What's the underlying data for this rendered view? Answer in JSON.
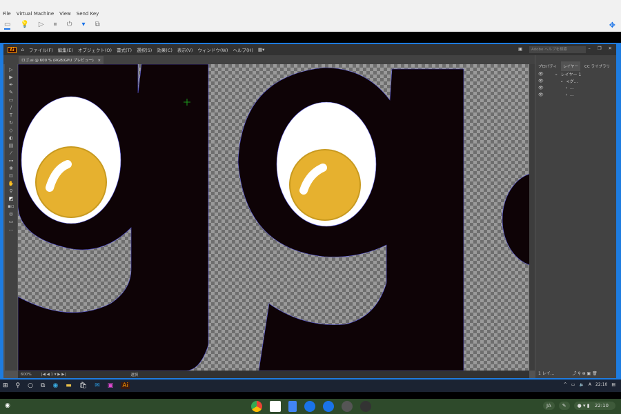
{
  "host": {
    "menu": [
      "File",
      "Virtual Machine",
      "View",
      "Send Key"
    ]
  },
  "illustrator": {
    "logo": "Ai",
    "menu": [
      "ファイル(F)",
      "編集(E)",
      "オブジェクト(O)",
      "書式(T)",
      "選択(S)",
      "効果(C)",
      "表示(V)",
      "ウィンドウ(W)",
      "ヘルプ(H)"
    ],
    "search_placeholder": "Adobe ヘルプを検索",
    "tab": "ロゴ.ai @ 600 % (RGB/GPU プレビュー)",
    "tab_close": "×",
    "panel_tabs": [
      "プロパティ",
      "レイヤー",
      "CC ライブラリ"
    ],
    "layers": [
      {
        "name": "レイヤー 1",
        "indent": 0
      },
      {
        "name": "<グ...",
        "indent": 1
      },
      {
        "name": "...",
        "indent": 2
      },
      {
        "name": "...",
        "indent": 2
      }
    ],
    "panel_status": "1 レイ...",
    "status": {
      "zoom": "600%",
      "artboard": "1",
      "tool": "選択"
    }
  },
  "taskbar": {
    "clock": "22:10"
  },
  "shelf": {
    "lang": "JA",
    "clock": "22:10"
  },
  "colors": {
    "letter": "#0e0306",
    "yolk": "#e6b12f",
    "accent": "#1e7ce0"
  }
}
